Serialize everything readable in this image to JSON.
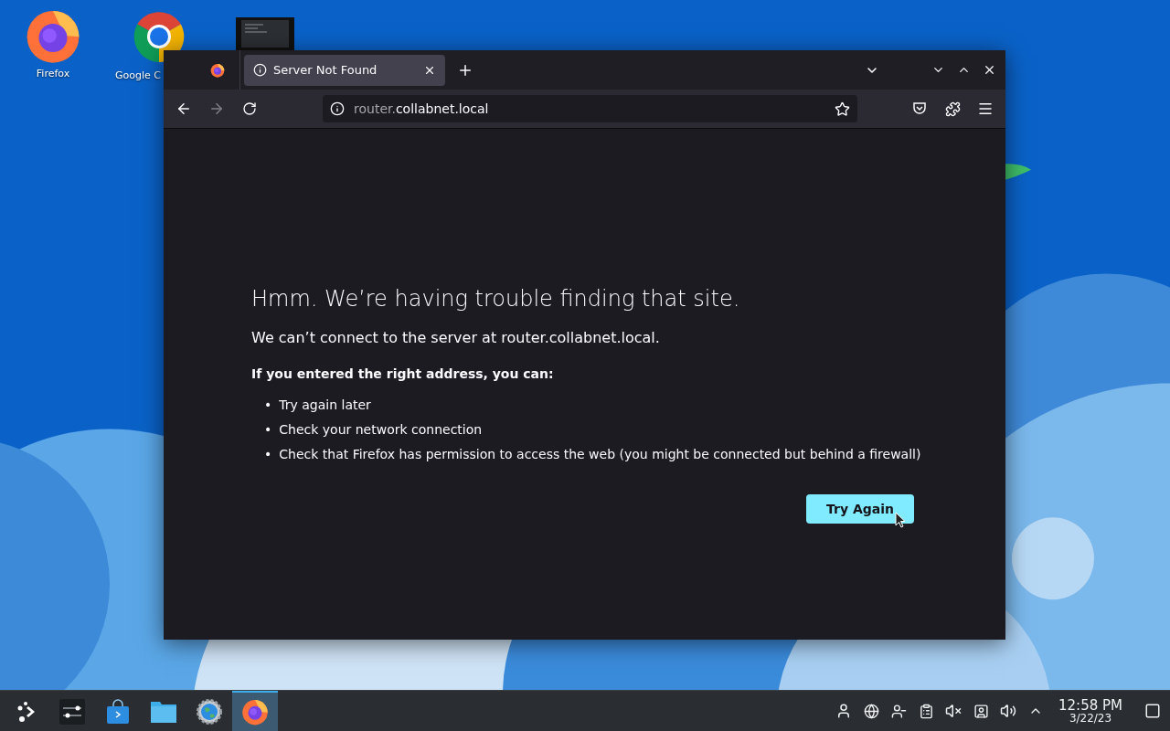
{
  "desktop_icons": [
    {
      "label": "Firefox"
    },
    {
      "label": "Google C"
    }
  ],
  "browser": {
    "tabs": [
      {
        "kind": "pinned",
        "selected": false
      },
      {
        "kind": "page",
        "title": "Server Not Found",
        "selected": true
      }
    ],
    "nav": {
      "back_disabled": false,
      "forward_disabled": true
    },
    "url": {
      "host_prefix": "router.",
      "domain": "collabnet.local"
    },
    "page": {
      "heading": "Hmm. We’re having trouble finding that site.",
      "message": "We can’t connect to the server at router.collabnet.local.",
      "advice_title": "If you entered the right address, you can:",
      "advice": [
        {
          "bullet": "•",
          "text": "Try again later"
        },
        {
          "bullet": "•",
          "text": "Check your network connection"
        },
        {
          "bullet": "•",
          "text": "Check that Firefox has permission to access the web (you might be connected but behind a firewall)"
        }
      ],
      "button": "Try Again"
    }
  },
  "taskbar": {
    "tasks": [
      {
        "kind": "launcher",
        "selected": false
      },
      {
        "kind": "settings",
        "selected": false
      },
      {
        "kind": "store",
        "selected": false
      },
      {
        "kind": "files",
        "selected": false
      },
      {
        "kind": "browser-settings",
        "selected": false
      },
      {
        "kind": "firefox",
        "selected": true
      }
    ],
    "clock": {
      "time": "12:58 PM",
      "date": "3/22/23"
    }
  }
}
